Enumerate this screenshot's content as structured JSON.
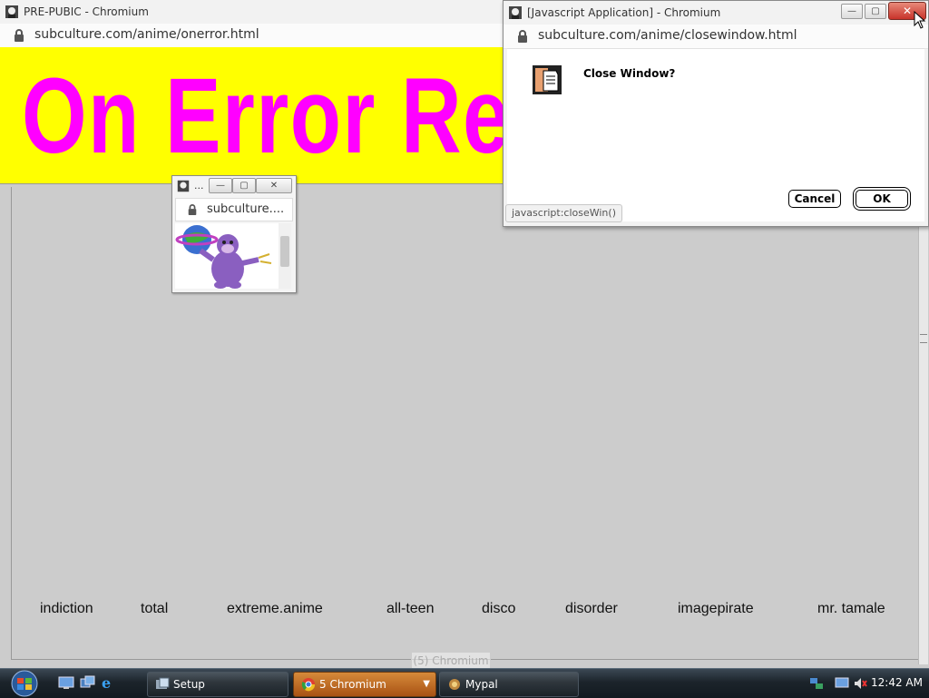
{
  "main_window": {
    "title": "PRE-PUBIC - Chromium",
    "url": "subculture.com/anime/onerror.html",
    "banner_text": "On Error Res",
    "links": [
      "indiction",
      "total",
      "extreme.anime",
      "all-teen",
      "disco",
      "disorder",
      "imagepirate",
      "mr. tamale"
    ]
  },
  "popup_window": {
    "title": "...",
    "url": "subculture...."
  },
  "dialog_window": {
    "title": "[Javascript Application] - Chromium",
    "url": "subculture.com/anime/closewindow.html",
    "message": "Close Window?",
    "cancel_label": "Cancel",
    "ok_label": "OK",
    "status_tip": "javascript:closeWin()"
  },
  "ghost_tooltip": "(5) Chromium",
  "taskbar": {
    "tasks": [
      {
        "label": "Setup"
      },
      {
        "label": "5 Chromium"
      },
      {
        "label": "Mypal"
      }
    ],
    "clock": "12:42 AM"
  },
  "colors": {
    "banner_bg": "#ffff00",
    "banner_text": "#ff00ff",
    "page_bg": "#cccccc"
  },
  "icons": [
    "bonzi-app-icon",
    "lock-icon",
    "minimize-icon",
    "maximize-icon",
    "close-icon",
    "document-alert-icon",
    "start-orb-icon",
    "show-desktop-icon",
    "switch-windows-icon",
    "ie-icon",
    "setup-icon",
    "chrome-icon",
    "mypal-icon",
    "network-icon",
    "volume-muted-icon",
    "monitor-icon"
  ]
}
